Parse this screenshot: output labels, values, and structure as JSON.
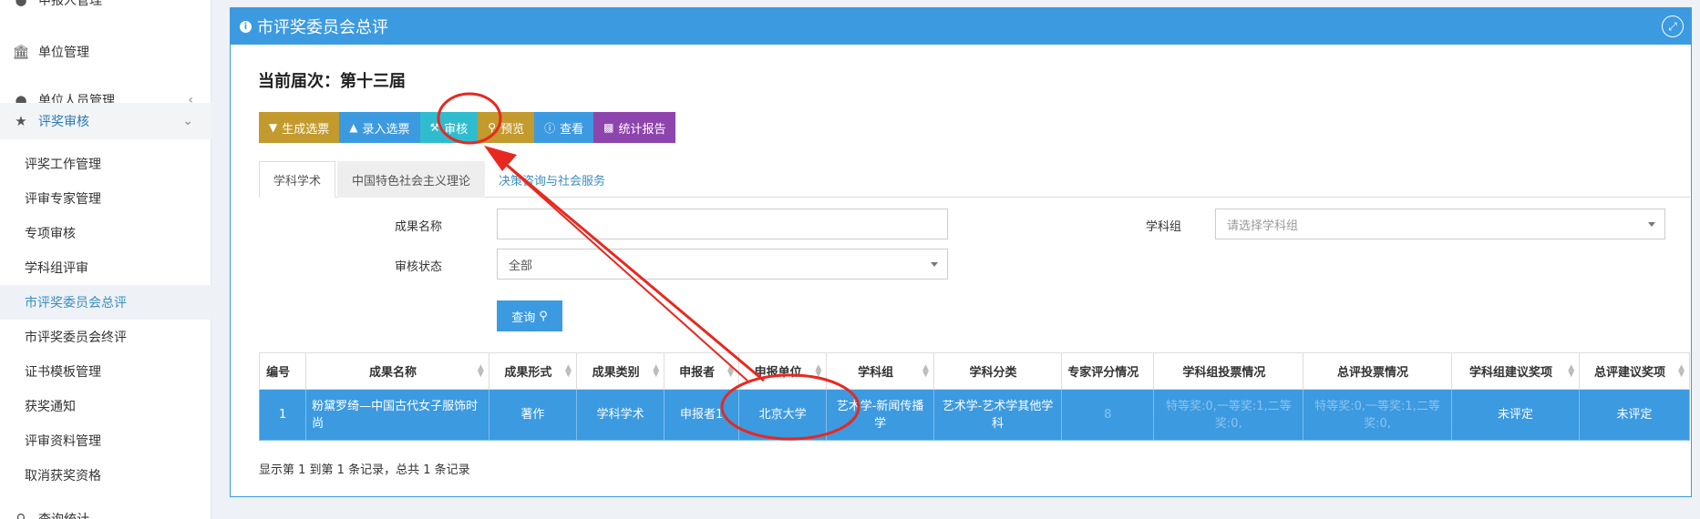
{
  "sidebar": {
    "items": [
      {
        "label": "申报人管理",
        "icon": "user-icon"
      },
      {
        "label": "单位管理",
        "icon": "bank-icon"
      },
      {
        "label": "单位人员管理",
        "icon": "users-icon"
      },
      {
        "label": "评奖审核",
        "icon": "trophy-icon"
      }
    ],
    "subitems": [
      "评奖工作管理",
      "评审专家管理",
      "专项审核",
      "学科组评审",
      "市评奖委员会总评",
      "市评奖委员会终评",
      "证书模板管理",
      "获奖通知",
      "评审资料管理",
      "取消获奖资格"
    ],
    "bottom_label": "查询统计"
  },
  "panel": {
    "title": "市评奖委员会总评",
    "session": "当前届次：第十三届"
  },
  "toolbar": {
    "generate": "生成选票",
    "record": "录入选票",
    "review": "审核",
    "preview": "预览",
    "view": "查看",
    "report": "统计报告"
  },
  "tabs": [
    "学科学术",
    "中国特色社会主义理论",
    "决策咨询与社会服务"
  ],
  "filters": {
    "name_label": "成果名称",
    "name_value": "",
    "status_label": "审核状态",
    "status_value": "全部",
    "group_label": "学科组",
    "group_placeholder": "请选择学科组",
    "query": "查询"
  },
  "table": {
    "headers": [
      "编号",
      "成果名称",
      "成果形式",
      "成果类别",
      "申报者",
      "申报单位",
      "学科组",
      "学科分类",
      "专家评分情况",
      "学科组投票情况",
      "总评投票情况",
      "学科组建议奖项",
      "总评建议奖项"
    ],
    "rows": [
      [
        "1",
        "粉黛罗绮—中国古代女子服饰时尚",
        "著作",
        "学科学术",
        "申报者1",
        "北京大学",
        "艺术学-新闻传播学",
        "艺术学-艺术学其他学科",
        "8",
        "特等奖:0,一等奖:1,二等奖:0,",
        "特等奖:0,一等奖:1,二等奖:0,",
        "未评定",
        "未评定"
      ]
    ]
  },
  "footer": "显示第 1 到第 1 条记录，总共 1 条记录",
  "colors": {
    "primary": "#3c9ae0",
    "gold": "#c39a2e",
    "cyan": "#2fbccf",
    "purple": "#8e44ad",
    "annotation": "#e8281f"
  }
}
